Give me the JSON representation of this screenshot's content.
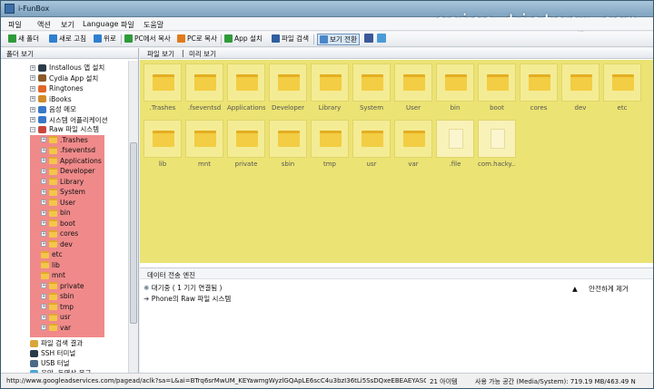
{
  "window": {
    "title": "i-FunBox",
    "watermark": "osios.tistory.com"
  },
  "menu": [
    "파일",
    "액션",
    "보기",
    "Language",
    "파일",
    "도움말"
  ],
  "toolbar": [
    {
      "label": "새 폴더",
      "color": "#2e9b3a",
      "icon": "plus-icon"
    },
    {
      "label": "새로 고침",
      "color": "#2f7fd0",
      "icon": "refresh-icon"
    },
    {
      "label": "위로",
      "color": "#2f7fd0",
      "icon": "up-arrow-icon"
    },
    {
      "label": "PC에서 복사",
      "color": "#2e9b3a",
      "icon": "copy-from-pc-icon"
    },
    {
      "label": "PC로 복사",
      "color": "#e07a1e",
      "icon": "copy-to-pc-icon"
    },
    {
      "label": "App 설치",
      "color": "#2e9b3a",
      "icon": "app-install-icon"
    },
    {
      "label": "파일 검색",
      "color": "#2f5fa0",
      "icon": "search-icon"
    },
    {
      "label": "보기 전환",
      "color": "#4a86c8",
      "icon": "view-switch-icon"
    }
  ],
  "left_pane": {
    "title": "폴더 보기"
  },
  "tree": {
    "top_items": [
      "Installous 앱 설치",
      "Cydia App 설치",
      "Ringtones",
      "iBooks",
      "음성 메모",
      "시스템 어플리케이션"
    ],
    "raw_root": "Raw 파일 시스템",
    "raw_children": [
      ".Trashes",
      ".fseventsd",
      "Applications",
      "Developer",
      "Library",
      "System",
      "User",
      "bin",
      "boot",
      "cores",
      "dev",
      "etc",
      "lib",
      "mnt",
      "private",
      "sbin",
      "tmp",
      "usr",
      "var"
    ],
    "bottom_items": [
      "파일 검색 결과",
      "SSH 터미널",
      "USB 터널",
      "음악, 동영상 복구"
    ]
  },
  "tabs": {
    "file_view": "파일 보기",
    "preview": "미리 보기"
  },
  "files": [
    {
      "name": ".Trashes",
      "kind": "folder"
    },
    {
      "name": ".fseventsd",
      "kind": "folder"
    },
    {
      "name": "Applications",
      "kind": "folder"
    },
    {
      "name": "Developer",
      "kind": "folder"
    },
    {
      "name": "Library",
      "kind": "folder"
    },
    {
      "name": "System",
      "kind": "folder"
    },
    {
      "name": "User",
      "kind": "folder"
    },
    {
      "name": "bin",
      "kind": "folder"
    },
    {
      "name": "boot",
      "kind": "folder"
    },
    {
      "name": "cores",
      "kind": "folder"
    },
    {
      "name": "dev",
      "kind": "folder"
    },
    {
      "name": "etc",
      "kind": "folder"
    },
    {
      "name": "lib",
      "kind": "folder"
    },
    {
      "name": "mnt",
      "kind": "folder"
    },
    {
      "name": "private",
      "kind": "folder"
    },
    {
      "name": "sbin",
      "kind": "folder"
    },
    {
      "name": "tmp",
      "kind": "folder"
    },
    {
      "name": "usr",
      "kind": "folder"
    },
    {
      "name": "var",
      "kind": "folder"
    },
    {
      "name": ".file",
      "kind": "file"
    },
    {
      "name": "com.hacky...",
      "kind": "file"
    }
  ],
  "transfer": {
    "title": "데이터 전송 엔진",
    "waiting": "대기중 ( 1 기기 연결됨 )",
    "device_path": "Phone의 Raw 파일 시스템",
    "safe_remove": "안전하게 제거"
  },
  "status": {
    "url": "http://www.googleadservices.com/pagead/aclk?sa=L&ai=BTrq6srMwUM_KEYawmgWyzlGQApLE6scC4u3bzI36tLi5SsDQxeEBEAEYASCpq7wU",
    "count": "21 아이템",
    "space": "사용 가능 공간 (Media/System): 719.19 MB/463.49 N"
  }
}
